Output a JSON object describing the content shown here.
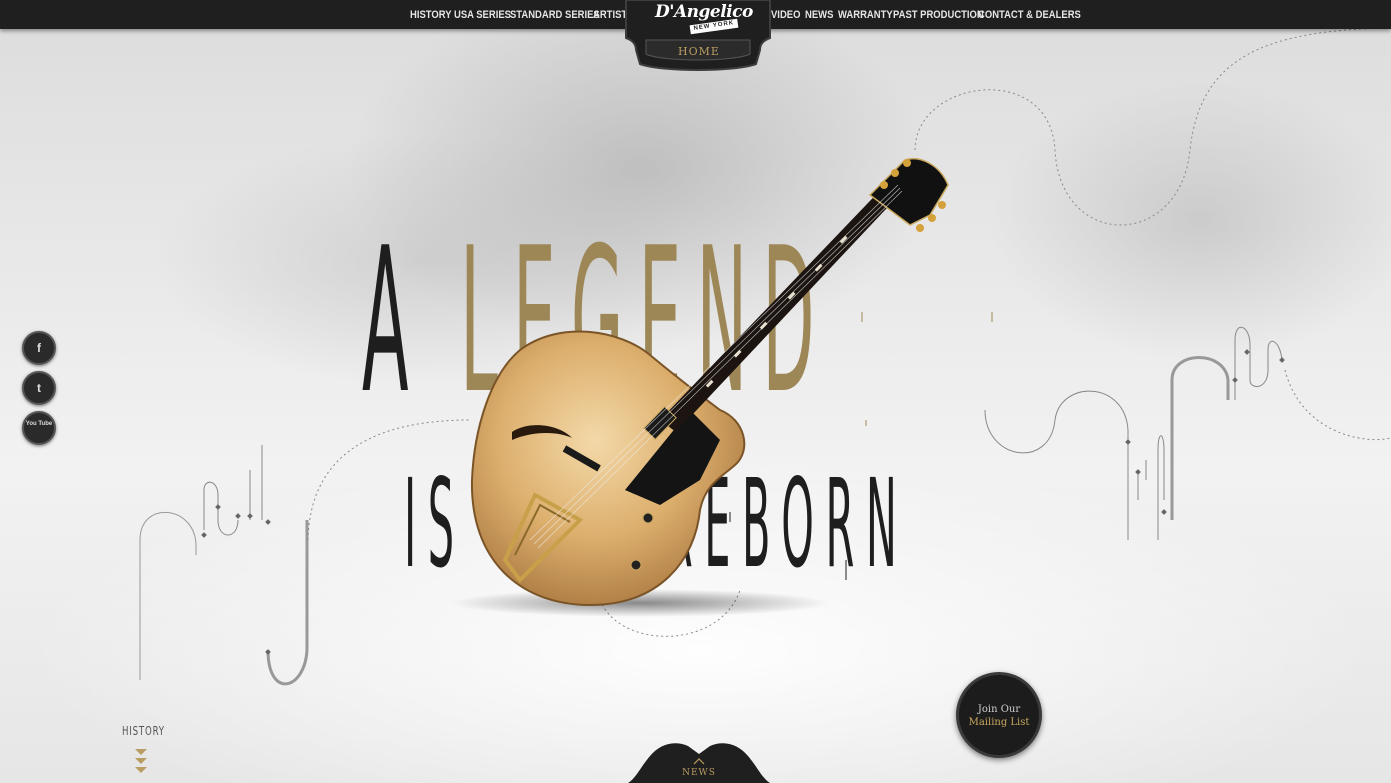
{
  "nav": {
    "left": [
      "HISTORY",
      "USA SERIES",
      "STANDARD SERIES",
      "ARTISTS"
    ],
    "right": [
      "VIDEO",
      "NEWS",
      "WARRANTY",
      "PAST PRODUCTION",
      "CONTACT & DEALERS"
    ],
    "logo_text": "D'Angelico",
    "logo_sub": "NEW YORK",
    "home_label": "HOME"
  },
  "hero": {
    "line1_first": "A",
    "line1_second": "LEGEND",
    "line2_first": "IS",
    "line2_second": "REBORN"
  },
  "social": [
    {
      "name": "facebook-icon",
      "glyph": "f"
    },
    {
      "name": "twitter-icon",
      "glyph": "t"
    },
    {
      "name": "youtube-icon",
      "glyph": "You Tube"
    }
  ],
  "mailing": {
    "line1": "Join Our",
    "line2": "Mailing List"
  },
  "history_label": "HISTORY",
  "news_label": "NEWS",
  "colors": {
    "bar": "#1f1f1f",
    "gold": "#9e8757",
    "ink": "#1e1e1e"
  }
}
